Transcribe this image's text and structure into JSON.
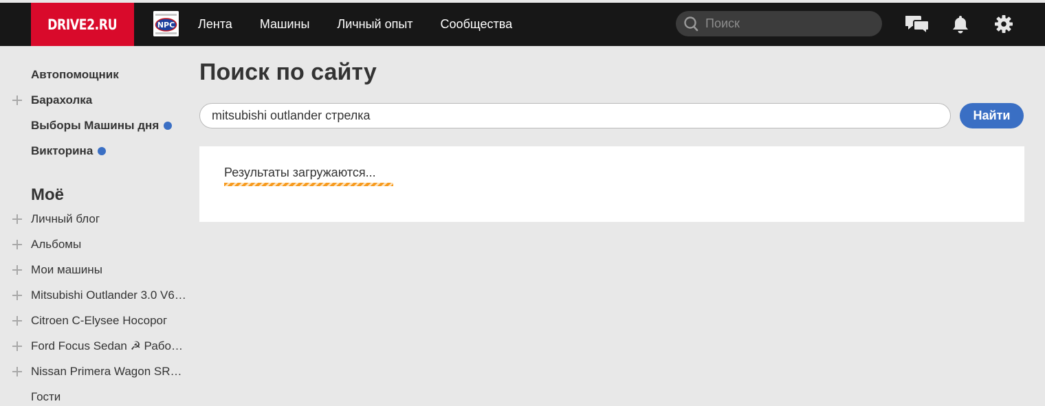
{
  "header": {
    "logo_text": "DRIVE2.RU",
    "club_badge_text": "NPC",
    "nav": [
      "Лента",
      "Машины",
      "Личный опыт",
      "Сообщества"
    ],
    "search_placeholder": "Поиск",
    "icons": [
      "chat-icon",
      "bell-icon",
      "gear-icon"
    ]
  },
  "sidebar": {
    "top_items": [
      {
        "label": "Автопомощник",
        "plus": false,
        "dot": false
      },
      {
        "label": "Барахолка",
        "plus": true,
        "dot": false
      },
      {
        "label": "Выборы Машины дня",
        "plus": false,
        "dot": true
      },
      {
        "label": "Викторина",
        "plus": false,
        "dot": true
      }
    ],
    "section_title": "Моё",
    "my_items": [
      {
        "label": "Личный блог",
        "plus": true
      },
      {
        "label": "Альбомы",
        "plus": true
      },
      {
        "label": "Мои машины",
        "plus": true
      },
      {
        "label": "Mitsubishi Outlander 3.0 V6…",
        "plus": true
      },
      {
        "label": "Citroen C-Elysee Носорог",
        "plus": true
      },
      {
        "label": "Ford Focus Sedan ☭ Рабо…",
        "plus": true
      },
      {
        "label": "Nissan Primera Wagon SR…",
        "plus": true
      },
      {
        "label": "Гости",
        "plus": false
      }
    ]
  },
  "main": {
    "title": "Поиск по сайту",
    "search_value": "mitsubishi outlander стрелка",
    "find_label": "Найти",
    "loading_text": "Результаты загружаются..."
  },
  "colors": {
    "topbar": "#171717",
    "logo": "#d90a2b",
    "accent_blue": "#3a6fc4",
    "loading_orange": "#f79a1e",
    "page_bg": "#e8e8e8"
  }
}
